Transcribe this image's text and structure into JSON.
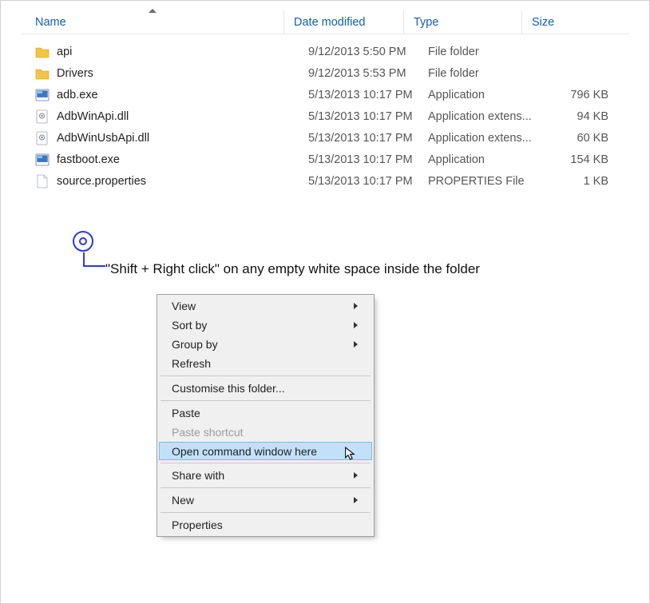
{
  "columns": {
    "name": "Name",
    "date": "Date modified",
    "type": "Type",
    "size": "Size"
  },
  "files": [
    {
      "icon": "folder",
      "name": "api",
      "date": "9/12/2013 5:50 PM",
      "type": "File folder",
      "size": ""
    },
    {
      "icon": "folder",
      "name": "Drivers",
      "date": "9/12/2013 5:53 PM",
      "type": "File folder",
      "size": ""
    },
    {
      "icon": "exe",
      "name": "adb.exe",
      "date": "5/13/2013 10:17 PM",
      "type": "Application",
      "size": "796 KB"
    },
    {
      "icon": "dll",
      "name": "AdbWinApi.dll",
      "date": "5/13/2013 10:17 PM",
      "type": "Application extens...",
      "size": "94 KB"
    },
    {
      "icon": "dll",
      "name": "AdbWinUsbApi.dll",
      "date": "5/13/2013 10:17 PM",
      "type": "Application extens...",
      "size": "60 KB"
    },
    {
      "icon": "exe",
      "name": "fastboot.exe",
      "date": "5/13/2013 10:17 PM",
      "type": "Application",
      "size": "154 KB"
    },
    {
      "icon": "file",
      "name": "source.properties",
      "date": "5/13/2013 10:17 PM",
      "type": "PROPERTIES File",
      "size": "1 KB"
    }
  ],
  "annotation": "\"Shift + Right click\" on any empty white space inside the folder",
  "menu": [
    {
      "kind": "item",
      "label": "View",
      "submenu": true
    },
    {
      "kind": "item",
      "label": "Sort by",
      "submenu": true
    },
    {
      "kind": "item",
      "label": "Group by",
      "submenu": true
    },
    {
      "kind": "item",
      "label": "Refresh"
    },
    {
      "kind": "sep"
    },
    {
      "kind": "item",
      "label": "Customise this folder..."
    },
    {
      "kind": "sep"
    },
    {
      "kind": "item",
      "label": "Paste"
    },
    {
      "kind": "item",
      "label": "Paste shortcut",
      "disabled": true
    },
    {
      "kind": "item",
      "label": "Open command window here",
      "highlight": true
    },
    {
      "kind": "sep"
    },
    {
      "kind": "item",
      "label": "Share with",
      "submenu": true
    },
    {
      "kind": "sep"
    },
    {
      "kind": "item",
      "label": "New",
      "submenu": true
    },
    {
      "kind": "sep"
    },
    {
      "kind": "item",
      "label": "Properties"
    }
  ]
}
